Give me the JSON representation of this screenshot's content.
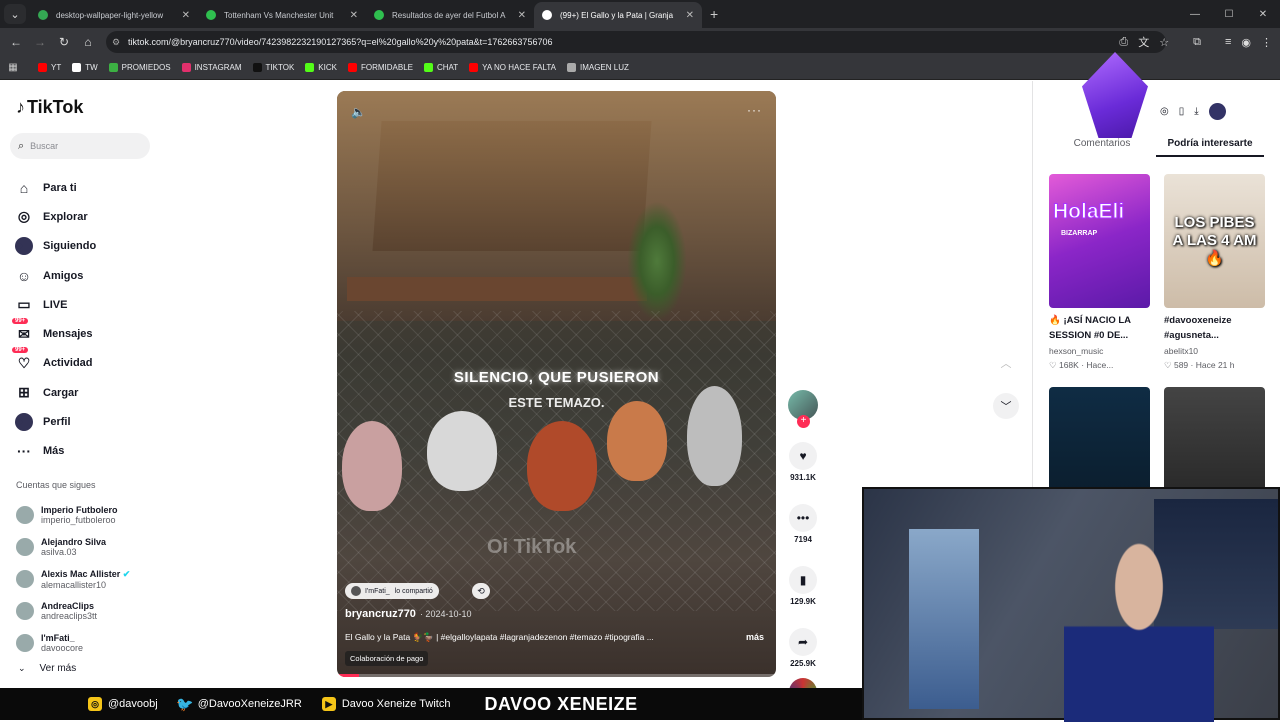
{
  "browser": {
    "tabs": [
      {
        "title": "desktop-wallpaper-light-yellow",
        "color": "#34a853",
        "active": false
      },
      {
        "title": "Tottenham Vs Manchester Unit",
        "color": "#2fbf4f",
        "active": false
      },
      {
        "title": "Resultados de ayer del Futbol A",
        "color": "#2fbf4f",
        "active": false
      },
      {
        "title": "(99+) El Gallo y la Pata | Granja",
        "color": "#ffffff",
        "active": true
      }
    ],
    "url": "tiktok.com/@bryancruz770/video/7423982232190127365?q=el%20gallo%20y%20pata&t=1762663756706",
    "bookmarks": [
      {
        "label": "YT",
        "color": "#ff0000"
      },
      {
        "label": "TW",
        "color": "#ffffff"
      },
      {
        "label": "PROMIEDOS",
        "color": "#3cb043"
      },
      {
        "label": "INSTAGRAM",
        "color": "#e1306c"
      },
      {
        "label": "TIKTOK",
        "color": "#111111"
      },
      {
        "label": "KICK",
        "color": "#53fc18"
      },
      {
        "label": "FORMIDABLE",
        "color": "#ff0000"
      },
      {
        "label": "CHAT",
        "color": "#53fc18"
      },
      {
        "label": "YA NO HACE FALTA",
        "color": "#ff0000"
      },
      {
        "label": "IMAGEN LUZ",
        "color": "#aaaaaa"
      }
    ]
  },
  "sidebar": {
    "logo": "TikTok",
    "search_placeholder": "Buscar",
    "nav": [
      {
        "label": "Para ti",
        "icon": "home-icon",
        "glyph": "⌂"
      },
      {
        "label": "Explorar",
        "icon": "compass-icon",
        "glyph": "◎"
      },
      {
        "label": "Siguiendo",
        "icon": "following-avatar-icon",
        "glyph": "●"
      },
      {
        "label": "Amigos",
        "icon": "friends-icon",
        "glyph": "☺"
      },
      {
        "label": "LIVE",
        "icon": "live-icon",
        "glyph": "▭"
      },
      {
        "label": "Mensajes",
        "icon": "messages-icon",
        "glyph": "✉",
        "badge": "99+"
      },
      {
        "label": "Actividad",
        "icon": "activity-icon",
        "glyph": "♡",
        "badge": "99+"
      },
      {
        "label": "Cargar",
        "icon": "upload-icon",
        "glyph": "⊞"
      },
      {
        "label": "Perfil",
        "icon": "profile-avatar-icon",
        "glyph": "●"
      },
      {
        "label": "Más",
        "icon": "more-icon",
        "glyph": "···"
      }
    ],
    "following_title": "Cuentas que sigues",
    "following": [
      {
        "name": "Imperio Futbolero",
        "handle": "imperio_futboleroo",
        "verified": false
      },
      {
        "name": "Alejandro Silva",
        "handle": "asilva.03",
        "verified": false
      },
      {
        "name": "Alexis Mac Allister",
        "handle": "alemacallister10",
        "verified": true
      },
      {
        "name": "AndreaClips",
        "handle": "andreaclips3tt",
        "verified": false
      },
      {
        "name": "I'mFati_",
        "handle": "davoocore",
        "verified": false
      }
    ],
    "ver_mas": "Ver más"
  },
  "video": {
    "caption_line1": "SILENCIO, QUE PUSIERON",
    "caption_line2": "ESTE TEMAZO.",
    "watermark": "Oi TikTok",
    "shared_by": "I'mFati_",
    "shared_text": "lo compartió",
    "author": "bryancruz770",
    "date": "· 2024-10-10",
    "description": "El Gallo y la Pata 🐓🦆 | #elgalloylapata #lagranjadezenon #temazo #tipografia ...",
    "more": "más",
    "collab": "Colaboración de pago",
    "progress": 0.05
  },
  "actions": {
    "likes": "931.1K",
    "comments": "7194",
    "saves": "129.9K",
    "shares": "225.9K"
  },
  "right": {
    "tabs": [
      "Comentarios",
      "Podría interesarte"
    ],
    "active_tab": 1,
    "cards": [
      {
        "thumb_text": "HolaEli",
        "thumb_sub": "BIZARRAP",
        "title": "🔥 ¡ASÍ NACIO LA SESSION #0 DE...",
        "user": "hexson_music",
        "likes": "♡ 168K",
        "time": "· Hace..."
      },
      {
        "thumb_text": "LOS PIBES A LAS 4 AM 🔥",
        "thumb_sub": "",
        "title": "#davooxeneize #agusneta...",
        "user": "abelitx10",
        "likes": "♡ 589",
        "time": "· Hace 21 h"
      },
      {
        "thumb_text": "",
        "thumb_sub": "",
        "title": "",
        "user": "",
        "likes": "",
        "time": ""
      },
      {
        "thumb_text": "",
        "thumb_sub": "",
        "title": "",
        "user": "",
        "likes": "",
        "time": ""
      }
    ]
  },
  "overlay": {
    "instagram": "@davoobj",
    "twitter": "@DavooXeneizeJRR",
    "twitch": "Davoo Xeneize Twitch",
    "name": "DAVOO XENEIZE"
  }
}
